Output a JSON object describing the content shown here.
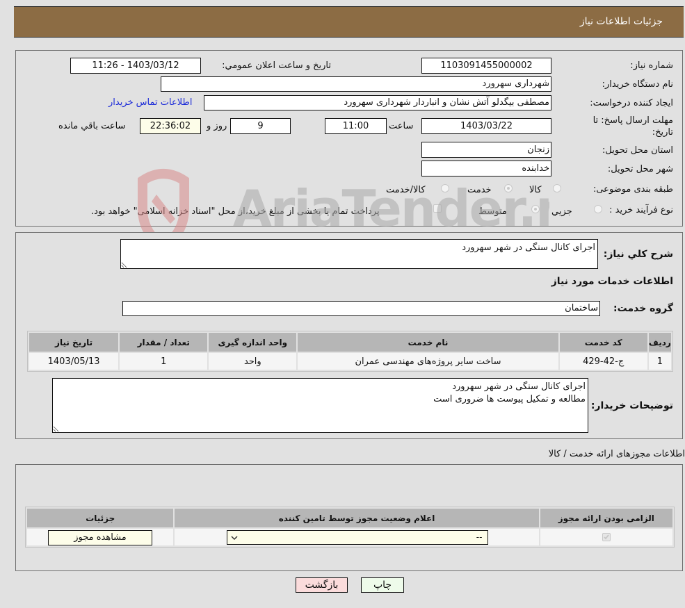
{
  "header": {
    "title": "جزئيات اطلاعات نیاز"
  },
  "info": {
    "need_number": {
      "label": "شماره نیاز:",
      "value": "1103091455000002"
    },
    "announce_datetime": {
      "label": "تاریخ و ساعت اعلان عمومي:",
      "value": "1403/03/12 - 11:26"
    },
    "buyer_org": {
      "label": "نام دستگاه خریدار:",
      "value": "شهرداری سهرورد"
    },
    "requester": {
      "label": "ایجاد کننده درخواست:",
      "value": "مصطفی بیگدلو آتش نشان و انباردار شهرداری سهرورد"
    },
    "buyer_contact_link": "اطلاعات تماس خریدار",
    "deadline": {
      "label_line1": "مهلت ارسال پاسخ: تا",
      "label_line2": "تاریخ:",
      "date": "1403/03/22",
      "time_label": "ساعت",
      "time": "11:00",
      "days": "9",
      "days_label": "روز و",
      "remaining": "22:36:02",
      "remaining_label": "ساعت باقي مانده"
    },
    "province": {
      "label": "استان محل تحویل:",
      "value": "زنجان"
    },
    "city": {
      "label": "شهر محل تحویل:",
      "value": "خدابنده"
    },
    "category": {
      "label": "طبقه بندی موضوعی:",
      "options": [
        "کالا",
        "خدمت",
        "کالا/خدمت"
      ],
      "selected": "خدمت"
    },
    "purchase_type": {
      "label": "نوع فرآیند خرید :",
      "options": [
        "جزيي",
        "متوسط"
      ],
      "selected": "متوسط",
      "treasury_note": "پرداخت تمام یا بخشی از مبلغ خرید،از محل \"اسناد خزانه اسلامی\" خواهد بود.",
      "treasury_checked": false
    }
  },
  "description": {
    "general_label": "شرح کلي نیاز:",
    "general_value": "اجرای کانال سنگی در شهر سهرورد",
    "services_heading": "اطلاعات خدمات مورد نیاز",
    "service_group_label": "گروه خدمت:",
    "service_group_value": "ساختمان"
  },
  "services_table": {
    "headers": [
      "ردیف",
      "کد خدمت",
      "نام خدمت",
      "واحد اندازه گیری",
      "تعداد / مقدار",
      "تاریخ نیاز"
    ],
    "rows": [
      [
        "1",
        "ج-42-429",
        "ساخت سایر پروژه‌های مهندسی عمران",
        "واحد",
        "1",
        "1403/05/13"
      ]
    ]
  },
  "buyer_notes": {
    "label": "توضیحات خریدار:",
    "value": "اجرای کانال سنگی در شهر سهرورد\nمطالعه و تمکیل پیوست ها ضروری است"
  },
  "permits": {
    "title": "اطلاعات مجوزهای ارائه خدمت / کالا",
    "headers": [
      "الزامی بودن ارائه مجوز",
      "اعلام وضعیت مجوز توسط تامین کننده",
      "جزئیات"
    ],
    "row": {
      "required_checked": true,
      "status_value": "--",
      "details_button": "مشاهده مجوز"
    }
  },
  "buttons": {
    "print": "چاپ",
    "back": "بازگشت"
  },
  "watermark": {
    "text": "AriaTender.neT"
  },
  "colors": {
    "header_bg": "#8c6c44",
    "link": "#1c2bd8",
    "print_bg": "#eefbea",
    "back_bg": "#fbdcdc"
  }
}
